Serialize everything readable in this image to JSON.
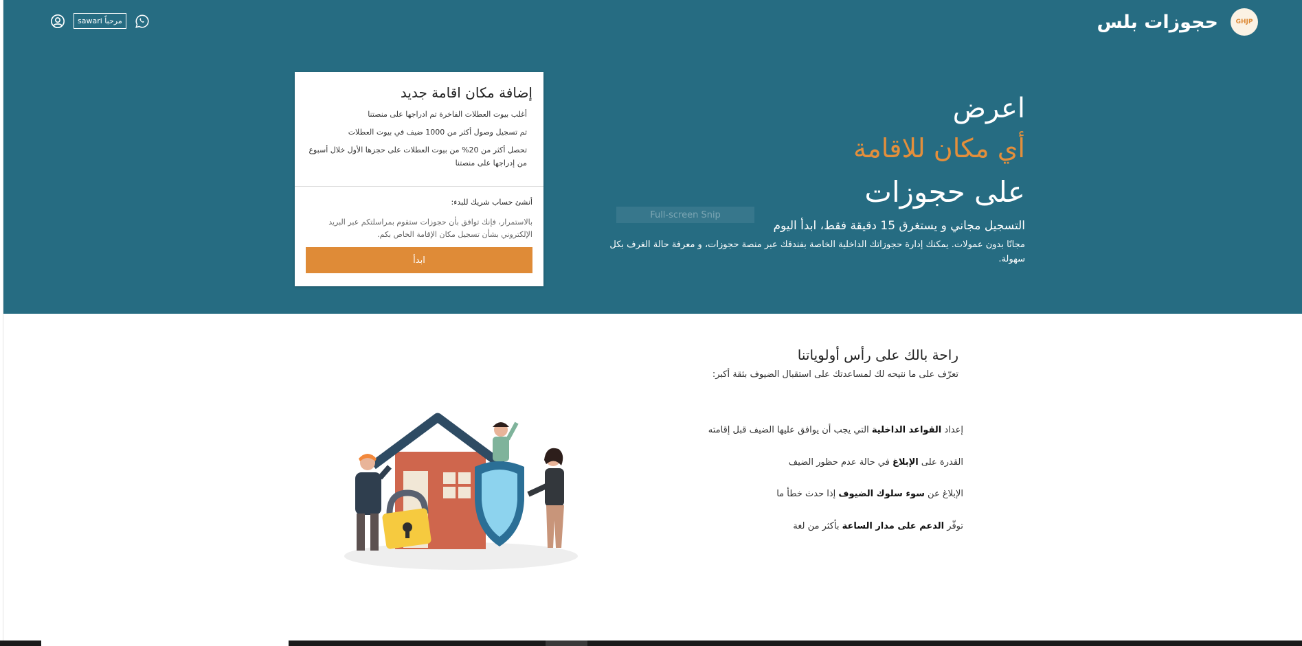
{
  "header": {
    "brand_name": "حجوزات بلس",
    "logo_text": "GHJP",
    "welcome_label": "مرحباً sawari"
  },
  "hero": {
    "line1": "اعرض",
    "line2": "أي مكان للاقامة",
    "line3": "على حجوزات",
    "line4": "التسجيل مجاني و يستغرق 15 دقيقة فقط، ابدأ اليوم",
    "line5": "مجانًا بدون عمولات. يمكنك إدارة حجوزاتك الداخلية الخاصة بفندقك عبر منصة حجوزات، و معرفة حالة الغرف بكل سهولة."
  },
  "card": {
    "title": "إضافة مكان اقامة جديد",
    "bullets": [
      "أغلب بيوت العطلات الفاخرة تم ادراجها على منصتنا",
      "تم تسجيل وصول أكثر من 1000 ضيف في بيوت العطلات",
      "تحصل أكثر من 20% من بيوت العطلات على حجزها الأول خلال أسبوع من إدراجها على منصتنا"
    ],
    "create_account_text": "أنشئ حساب شريك للبدء:",
    "terms_text": "بالاستمرار، فإنك توافق بأن حجوزات ستقوم بمراسلتكم عبر البريد الإلكتروني بشأن تسجيل مكان الإقامة الخاص بكم.",
    "start_button": "ابدأ"
  },
  "overlay": {
    "snip_text": "Full-screen Snip"
  },
  "section": {
    "title": "راحة بالك على رأس أولوياتنا",
    "subtitle": "تعرّف على ما نتيحه لك لمساعدتك على استقبال الضيوف بثقة أكبر:"
  },
  "features": [
    {
      "before": "إعداد ",
      "bold": "القواعد الداخلية",
      "after": " التي يجب أن يوافق عليها الضيف قبل إقامته"
    },
    {
      "before": "القدرة على ",
      "bold": "الإبلاغ",
      "after": " في حالة عدم حظور الضيف"
    },
    {
      "before": "الإبلاغ عن ",
      "bold": "سوء سلوك الضيوف",
      "after": " إذا حدث خطأ ما"
    },
    {
      "before": "توفّر ",
      "bold": "الدعم على مدار الساعة",
      "after": " بأكثر من لغة"
    }
  ],
  "colors": {
    "hero_bg": "#266c82",
    "accent": "#df8b37",
    "highlight_text": "#e48f3b"
  },
  "icons": {
    "user": "user-circle-icon",
    "whatsapp": "whatsapp-icon"
  }
}
